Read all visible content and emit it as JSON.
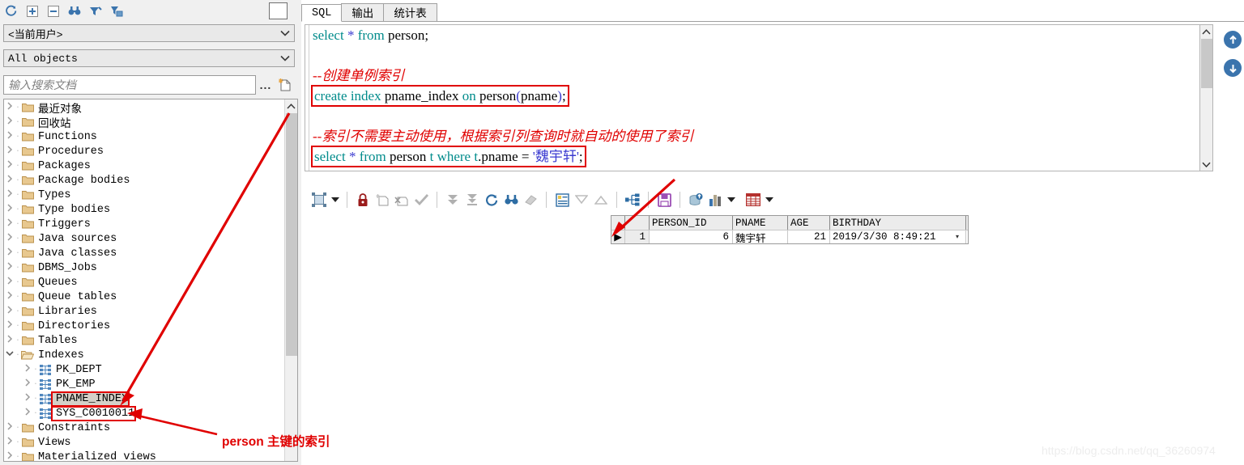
{
  "left_panel": {
    "toolbar_icons": [
      "refresh-icon",
      "expand-all-icon",
      "collapse-all-icon",
      "find-icon",
      "filter-icon",
      "filter-folder-icon"
    ],
    "user_combo": {
      "value": "<当前用户>",
      "caret": "chevron-down-icon"
    },
    "objects_combo": {
      "value": "All objects",
      "caret": "chevron-down-icon"
    },
    "search": {
      "placeholder": "输入搜索文档",
      "value": "",
      "ellipsis": "...",
      "new_doc_icon": "new-document-icon"
    },
    "tree": [
      {
        "label": "最近对象",
        "icon": "folder-icon",
        "level": 1,
        "expander": "chevron-right-icon",
        "state": "collapsed"
      },
      {
        "label": "回收站",
        "icon": "folder-icon",
        "level": 1,
        "expander": "chevron-right-icon",
        "state": "collapsed"
      },
      {
        "label": "Functions",
        "icon": "folder-icon",
        "level": 1,
        "expander": "chevron-right-icon",
        "state": "collapsed"
      },
      {
        "label": "Procedures",
        "icon": "folder-icon",
        "level": 1,
        "expander": "chevron-right-icon",
        "state": "collapsed"
      },
      {
        "label": "Packages",
        "icon": "folder-icon",
        "level": 1,
        "expander": "chevron-right-icon",
        "state": "collapsed"
      },
      {
        "label": "Package bodies",
        "icon": "folder-icon",
        "level": 1,
        "expander": "chevron-right-icon",
        "state": "collapsed"
      },
      {
        "label": "Types",
        "icon": "folder-icon",
        "level": 1,
        "expander": "chevron-right-icon",
        "state": "collapsed"
      },
      {
        "label": "Type bodies",
        "icon": "folder-icon",
        "level": 1,
        "expander": "chevron-right-icon",
        "state": "collapsed"
      },
      {
        "label": "Triggers",
        "icon": "folder-icon",
        "level": 1,
        "expander": "chevron-right-icon",
        "state": "collapsed"
      },
      {
        "label": "Java sources",
        "icon": "folder-icon",
        "level": 1,
        "expander": "chevron-right-icon",
        "state": "collapsed"
      },
      {
        "label": "Java classes",
        "icon": "folder-icon",
        "level": 1,
        "expander": "chevron-right-icon",
        "state": "collapsed"
      },
      {
        "label": "DBMS_Jobs",
        "icon": "folder-icon",
        "level": 1,
        "expander": "chevron-right-icon",
        "state": "collapsed"
      },
      {
        "label": "Queues",
        "icon": "folder-icon",
        "level": 1,
        "expander": "chevron-right-icon",
        "state": "collapsed"
      },
      {
        "label": "Queue tables",
        "icon": "folder-icon",
        "level": 1,
        "expander": "chevron-right-icon",
        "state": "collapsed"
      },
      {
        "label": "Libraries",
        "icon": "folder-icon",
        "level": 1,
        "expander": "chevron-right-icon",
        "state": "collapsed"
      },
      {
        "label": "Directories",
        "icon": "folder-icon",
        "level": 1,
        "expander": "chevron-right-icon",
        "state": "collapsed"
      },
      {
        "label": "Tables",
        "icon": "folder-icon",
        "level": 1,
        "expander": "chevron-right-icon",
        "state": "collapsed"
      },
      {
        "label": "Indexes",
        "icon": "folder-open-icon",
        "level": 1,
        "expander": "chevron-down-icon",
        "state": "expanded"
      },
      {
        "label": "PK_DEPT",
        "icon": "index-icon",
        "level": 2,
        "expander": "chevron-right-icon",
        "state": "collapsed"
      },
      {
        "label": "PK_EMP",
        "icon": "index-icon",
        "level": 2,
        "expander": "chevron-right-icon",
        "state": "collapsed"
      },
      {
        "label": "PNAME_INDEX",
        "icon": "index-icon",
        "level": 2,
        "expander": "chevron-right-icon",
        "state": "collapsed",
        "selected": true,
        "highlighted": true
      },
      {
        "label": "SYS_C0010011",
        "icon": "index-icon",
        "level": 2,
        "expander": "chevron-right-icon",
        "state": "collapsed",
        "highlighted": true
      },
      {
        "label": "Constraints",
        "icon": "folder-icon",
        "level": 1,
        "expander": "chevron-right-icon",
        "state": "collapsed"
      },
      {
        "label": "Views",
        "icon": "folder-icon",
        "level": 1,
        "expander": "chevron-right-icon",
        "state": "collapsed"
      },
      {
        "label": "Materialized views",
        "icon": "folder-icon",
        "level": 1,
        "expander": "chevron-right-icon",
        "state": "collapsed"
      }
    ],
    "scrollbar": {
      "up": "chevron-up-icon",
      "down": "chevron-down-icon"
    }
  },
  "right_panel": {
    "tabs": [
      {
        "label": "SQL",
        "active": true
      },
      {
        "label": "输出",
        "active": false
      },
      {
        "label": "统计表",
        "active": false
      }
    ],
    "editor": {
      "lines": [
        {
          "id": "l1",
          "type": "sql",
          "text": "select * from person;",
          "boxed": false
        },
        {
          "id": "l2",
          "type": "blank",
          "text": ""
        },
        {
          "id": "l3",
          "type": "comment",
          "text": "--创建单例索引"
        },
        {
          "id": "l4",
          "type": "sql",
          "text": "create index pname_index on person(pname);",
          "boxed": true
        },
        {
          "id": "l5",
          "type": "blank",
          "text": ""
        },
        {
          "id": "l6",
          "type": "comment",
          "text": "--索引不需要主动使用，根据索引列查询时就自动的使用了索引"
        },
        {
          "id": "l7",
          "type": "sql",
          "text": "select * from person t where t.pname = '魏宇轩';",
          "boxed": true
        }
      ],
      "scrollbar": {
        "up": "chevron-up-icon",
        "down": "chevron-down-icon"
      }
    },
    "nav_buttons": [
      {
        "name": "scroll-up-circle",
        "glyph": "↑"
      },
      {
        "name": "scroll-down-circle",
        "glyph": "↓"
      }
    ],
    "results_toolbar": [
      {
        "name": "grid-mode-button",
        "icon": "grid-select-icon"
      },
      {
        "name": "grid-mode-dropdown",
        "icon": "caret-down-icon"
      },
      {
        "name": "sep1",
        "icon": "separator"
      },
      {
        "name": "lock-button",
        "icon": "lock-icon"
      },
      {
        "name": "insert-record-button",
        "icon": "new-record-icon"
      },
      {
        "name": "delete-record-button",
        "icon": "delete-record-icon"
      },
      {
        "name": "post-changes-button",
        "icon": "check-icon"
      },
      {
        "name": "sep2",
        "icon": "separator"
      },
      {
        "name": "fetch-next-page-button",
        "icon": "double-down-icon"
      },
      {
        "name": "fetch-last-page-button",
        "icon": "down-to-bar-icon"
      },
      {
        "name": "refresh-button",
        "icon": "refresh-icon"
      },
      {
        "name": "find-button",
        "icon": "binoculars-icon"
      },
      {
        "name": "clear-filter-button",
        "icon": "eraser-icon"
      },
      {
        "name": "sep3",
        "icon": "separator"
      },
      {
        "name": "single-record-view-button",
        "icon": "record-view-icon"
      },
      {
        "name": "filter-dropdown-button",
        "icon": "filter-down-icon"
      },
      {
        "name": "sort-up-button",
        "icon": "triangle-up-icon"
      },
      {
        "name": "sep4",
        "icon": "separator"
      },
      {
        "name": "links-button",
        "icon": "hierarchy-icon"
      },
      {
        "name": "sep5",
        "icon": "separator"
      },
      {
        "name": "save-button",
        "icon": "floppy-save-icon"
      },
      {
        "name": "sep6",
        "icon": "separator"
      },
      {
        "name": "export-db-button",
        "icon": "db-upload-icon"
      },
      {
        "name": "chart-button",
        "icon": "bar-chart-icon"
      },
      {
        "name": "chart-dropdown",
        "icon": "caret-down-icon"
      },
      {
        "name": "table-button",
        "icon": "table-grid-icon"
      },
      {
        "name": "table-dropdown",
        "icon": "caret-down-icon"
      }
    ],
    "grid": {
      "columns": [
        "PERSON_ID",
        "PNAME",
        "AGE",
        "BIRTHDAY"
      ],
      "rows": [
        {
          "marker": "▶",
          "num": "1",
          "PERSON_ID": "6",
          "PNAME": "魏宇轩",
          "AGE": "21",
          "BIRTHDAY": "2019/3/30 8:49:21"
        }
      ],
      "birthday_dropdown_icon": "caret-down-icon"
    }
  },
  "annotations": {
    "callout_text": "person 主键的索引",
    "arrow_color": "#e00000"
  },
  "watermark": "https://blog.csdn.net/qq_36260974",
  "colors": {
    "accent_blue": "#3b74ad",
    "annotation_red": "#e00000",
    "keyword_teal": "#008b8b",
    "string_blue": "#3a3ad0",
    "panel_bg": "#f0f0f0"
  }
}
